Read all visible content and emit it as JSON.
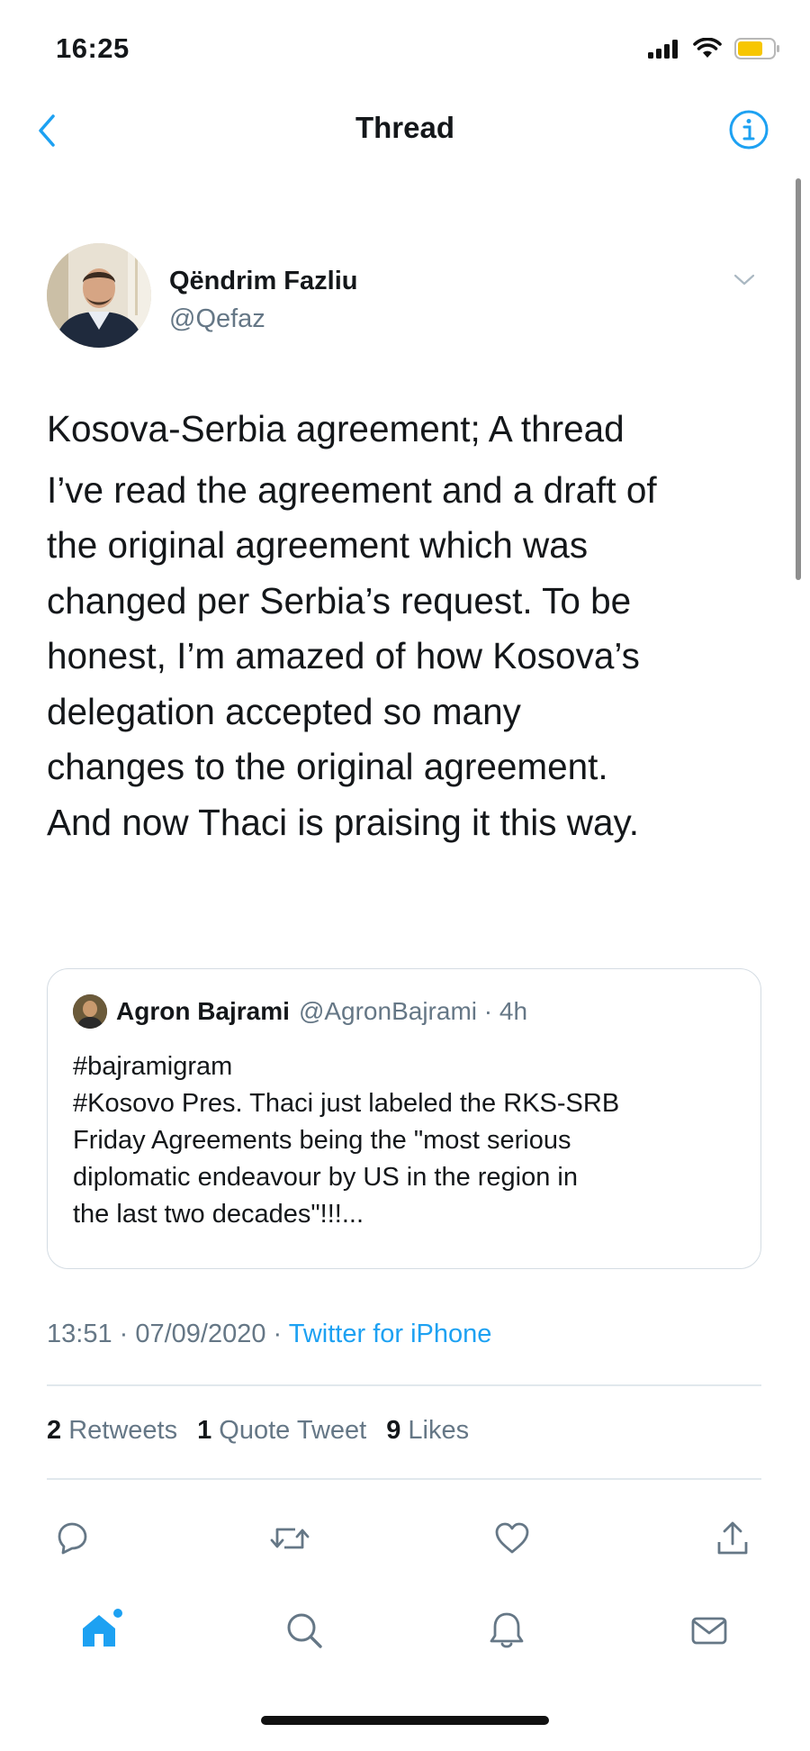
{
  "status_bar": {
    "time": "16:25",
    "battery_color": "#f7c600",
    "icons": [
      "signal-icon",
      "wifi-icon",
      "battery-icon"
    ]
  },
  "nav": {
    "title": "Thread",
    "back_icon": "chevron-left-icon",
    "info_icon": "info-icon",
    "accent": "#1da1f2"
  },
  "tweet": {
    "author_name": "Qëndrim Fazliu",
    "author_handle": "@Qefaz",
    "text_lines_p1": [
      "Kosova-Serbia agreement; A thread"
    ],
    "text_lines_p2": [
      "I’ve read the agreement and a draft of",
      "the original agreement which was",
      "changed per Serbia’s request. To be",
      "honest, I’m amazed of how Kosova’s",
      "delegation accepted so many",
      "changes to the original agreement.",
      "And now Thaci is praising it this way."
    ],
    "quoted": {
      "name": "Agron Bajrami",
      "handle_time": "@AgronBajrami · 4h",
      "lines": [
        "#bajramigram",
        "#Kosovo Pres. Thaci just labeled the RKS-SRB",
        "Friday Agreements being the \"most serious",
        "diplomatic endeavour by US in the region in",
        "the last two decades\"!!!..."
      ]
    },
    "timestamp": "13:51 · 07/09/2020 · ",
    "client": "Twitter for iPhone",
    "stats": {
      "retweets_count": "2",
      "retweets_label": " Retweets",
      "quotes_count": "1",
      "quotes_label": " Quote Tweet",
      "likes_count": "9",
      "likes_label": " Likes"
    }
  },
  "actions": [
    "reply-icon",
    "retweet-icon",
    "like-icon",
    "share-icon"
  ],
  "tabbar": {
    "tabs": [
      "home-icon",
      "search-icon",
      "notifications-icon",
      "messages-icon"
    ],
    "active": "home-icon"
  }
}
